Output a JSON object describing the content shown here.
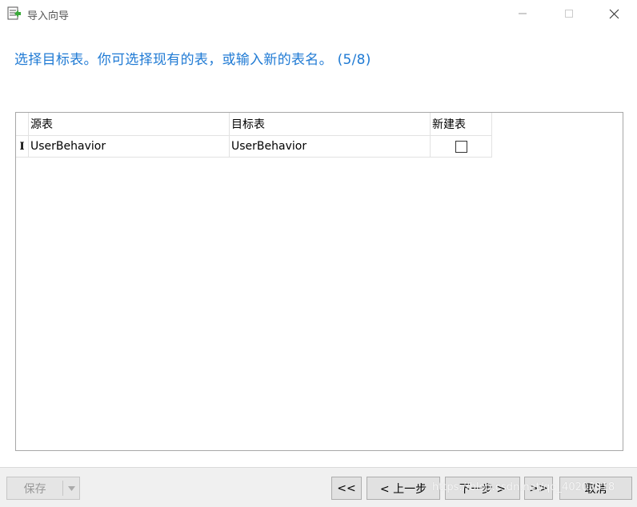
{
  "window": {
    "title": "导入向导",
    "icon": "import-wizard-icon"
  },
  "heading": "选择目标表。你可选择现有的表，或输入新的表名。 (5/8)",
  "grid": {
    "columns": [
      "源表",
      "目标表",
      "新建表"
    ],
    "rows": [
      {
        "indicator": "I",
        "source": "UserBehavior",
        "target": "UserBehavior",
        "new_table": false
      }
    ]
  },
  "buttons": {
    "save": "保存",
    "first": "<<",
    "prev": "< 上一步",
    "next": "下一步 >",
    "last": ">>",
    "cancel": "取消"
  },
  "watermark": "https://blog.csdn.net/qq_40203818",
  "colors": {
    "accent": "#1f7ad4",
    "bottom_bar": "#f0f0f0",
    "button_face": "#e1e1e1"
  }
}
